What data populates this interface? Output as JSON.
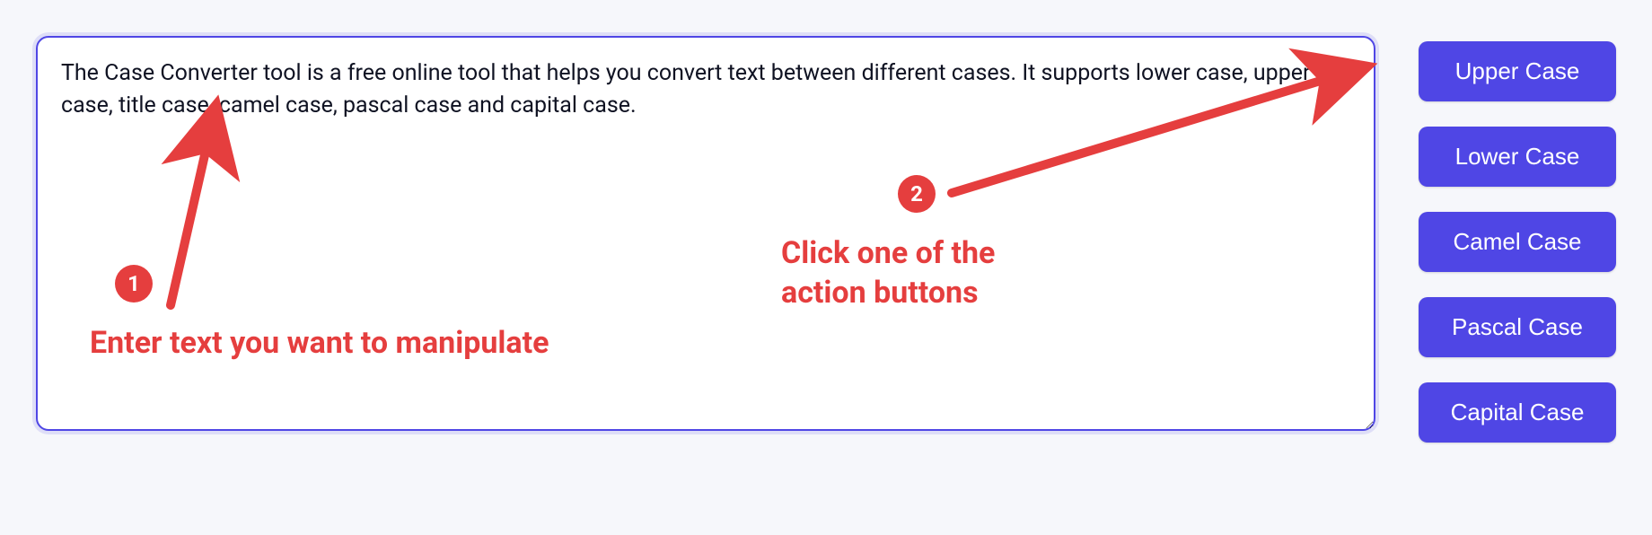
{
  "textarea": {
    "value": "The Case Converter tool is a free online tool that helps you convert text between different cases. It supports lower case, upper case, title case, camel case, pascal case and capital case. ",
    "placeholder": ""
  },
  "buttons": [
    {
      "label": "Upper Case"
    },
    {
      "label": "Lower Case"
    },
    {
      "label": "Camel Case"
    },
    {
      "label": "Pascal Case"
    },
    {
      "label": "Capital Case"
    }
  ],
  "annotations": {
    "step1": {
      "badge": "1",
      "text": "Enter text you want to manipulate"
    },
    "step2": {
      "badge": "2",
      "text": "Click one of the action buttons"
    }
  },
  "colors": {
    "accent": "#4f46e5",
    "annotation": "#e53e3e"
  }
}
